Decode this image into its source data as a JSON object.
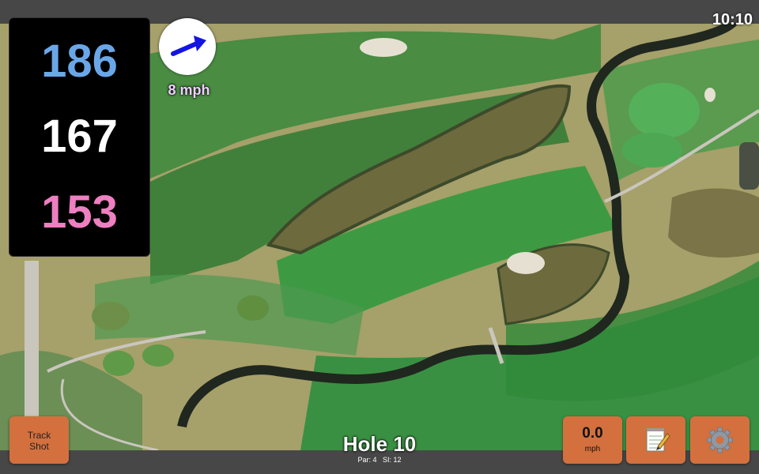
{
  "status": {
    "time": "10:10"
  },
  "distances": {
    "back": "186",
    "middle": "167",
    "front": "153"
  },
  "wind": {
    "speed_label": "8 mph"
  },
  "track_button": {
    "line1": "Track",
    "line2": "Shot"
  },
  "hole": {
    "title": "Hole 10",
    "par_label": "Par: 4",
    "si_label": "SI: 12"
  },
  "speed_display": {
    "value": "0.0",
    "unit": "mph"
  },
  "icons": {
    "notes": "notepad-icon",
    "settings": "gear-icon",
    "wind": "wind-direction-arrow-icon"
  },
  "colors": {
    "back": "#6aa7e8",
    "middle": "#ffffff",
    "front": "#ee7fc1",
    "button": "#d4703e",
    "wind_label": "#f0d0ff"
  }
}
